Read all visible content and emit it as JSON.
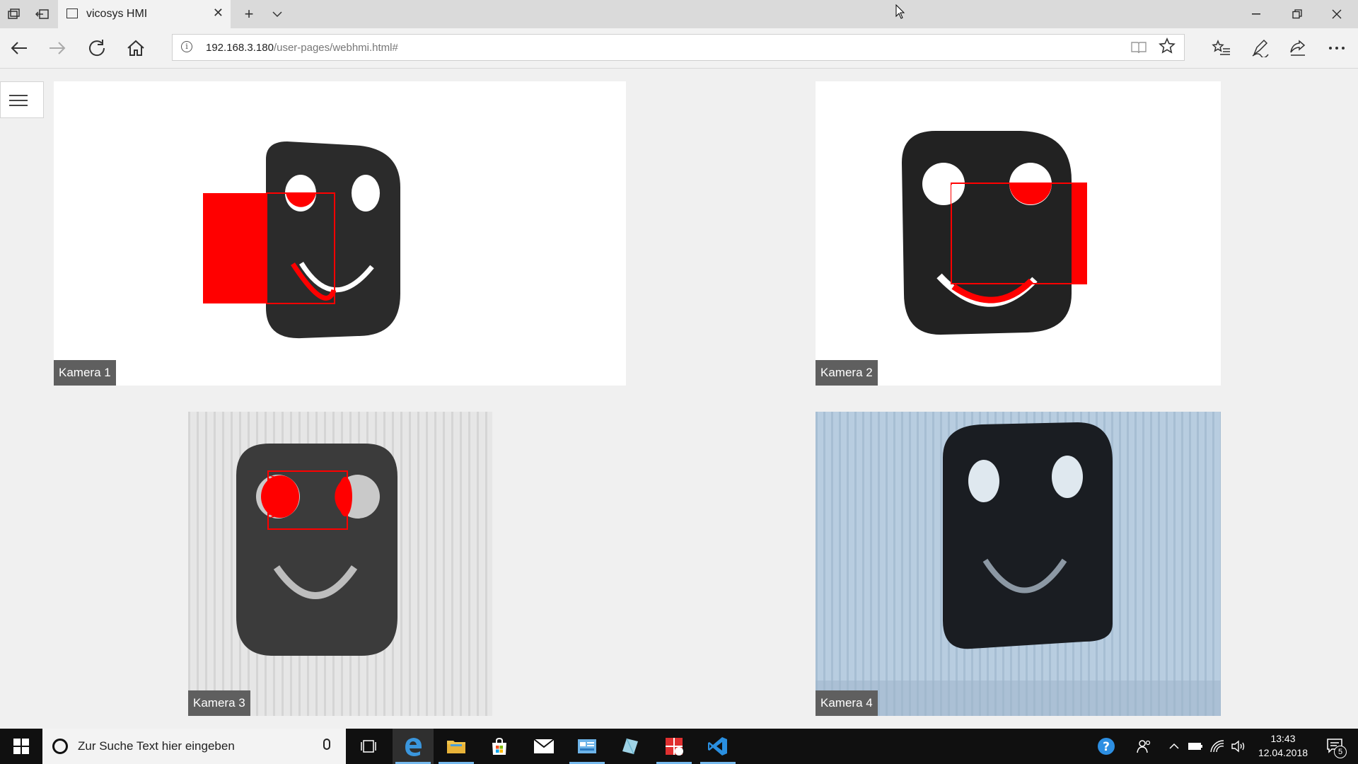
{
  "browser": {
    "tab_title": "vicosys HMI",
    "tab_close": "✕",
    "new_tab": "+",
    "tab_list": "⌄",
    "url_host": "192.168.3.180",
    "url_path": "/user-pages/webhmi.html#",
    "window_controls": {
      "minimize": "—",
      "restore": "❐",
      "close": "✕"
    },
    "icons": [
      "tab-preview-icon",
      "set-aside-tabs-icon",
      "back-icon",
      "forward-icon",
      "refresh-icon",
      "home-icon",
      "info-icon",
      "reading-view-icon",
      "favorite-star-icon",
      "favorites-hub-icon",
      "notes-pen-icon",
      "share-icon",
      "more-icon"
    ]
  },
  "page": {
    "cameras": [
      {
        "label": "Kamera 1"
      },
      {
        "label": "Kamera 2"
      },
      {
        "label": "Kamera 3"
      },
      {
        "label": "Kamera 4"
      }
    ]
  },
  "taskbar": {
    "search_placeholder": "Zur Suche Text hier eingeben",
    "time": "13:43",
    "date": "12.04.2018",
    "notification_count": "5",
    "accent_color": "#76b9ed",
    "apps": [
      "edge",
      "file-explorer",
      "store",
      "mail",
      "app-blue",
      "app-crystal",
      "app-red",
      "vscode"
    ]
  },
  "colors": {
    "overlay_red": "#ff0000",
    "page_bg": "#f0f0f0",
    "label_bg": "#5f5f5f"
  }
}
